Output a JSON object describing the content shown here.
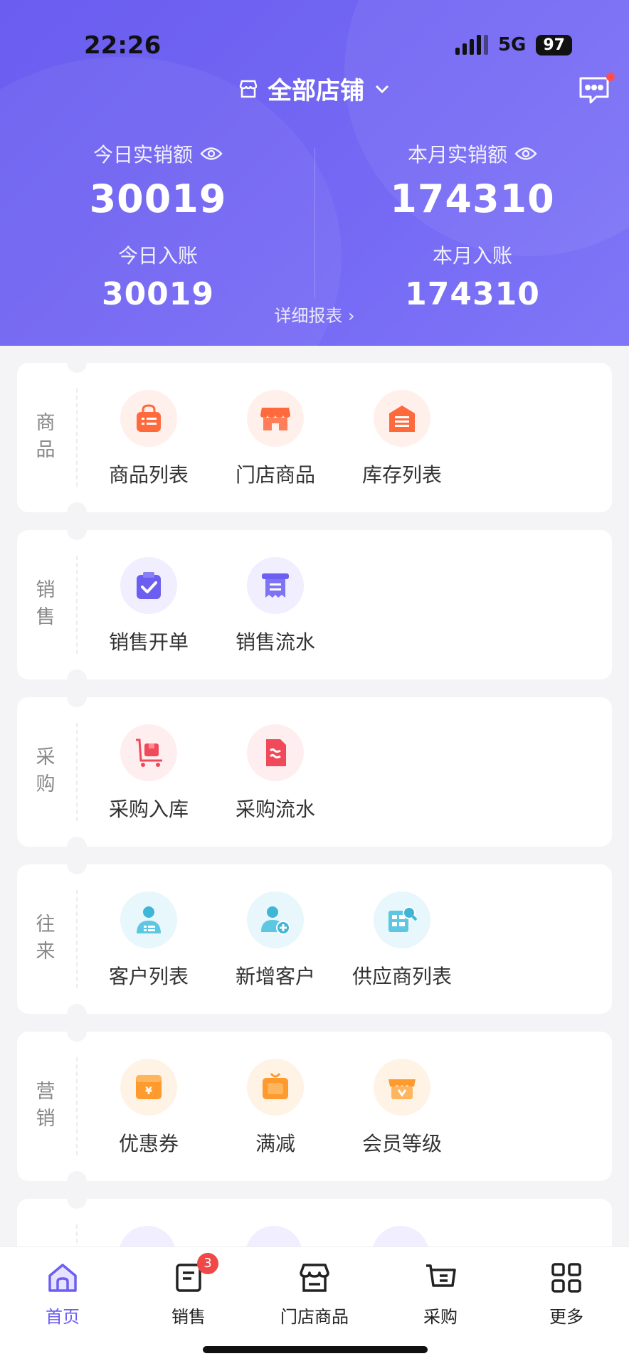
{
  "status_bar": {
    "time": "22:26",
    "network": "5G",
    "battery": "97"
  },
  "header": {
    "store_selector": "全部店铺",
    "stats": {
      "today_sales_label": "今日实销额",
      "today_sales_value": "30019",
      "month_sales_label": "本月实销额",
      "month_sales_value": "174310",
      "today_income_label": "今日入账",
      "today_income_value": "30019",
      "month_income_label": "本月入账",
      "month_income_value": "174310"
    },
    "detail_link": "详细报表 ›"
  },
  "sections": [
    {
      "label": "商品",
      "items": [
        {
          "label": "商品列表",
          "icon": "shopping-bag-icon"
        },
        {
          "label": "门店商品",
          "icon": "storefront-icon"
        },
        {
          "label": "库存列表",
          "icon": "warehouse-icon"
        }
      ]
    },
    {
      "label": "销售",
      "items": [
        {
          "label": "销售开单",
          "icon": "clipboard-check-icon"
        },
        {
          "label": "销售流水",
          "icon": "receipt-icon"
        }
      ]
    },
    {
      "label": "采购",
      "items": [
        {
          "label": "采购入库",
          "icon": "cart-box-icon"
        },
        {
          "label": "采购流水",
          "icon": "document-icon"
        }
      ]
    },
    {
      "label": "往来",
      "items": [
        {
          "label": "客户列表",
          "icon": "customer-icon"
        },
        {
          "label": "新增客户",
          "icon": "add-customer-icon"
        },
        {
          "label": "供应商列表",
          "icon": "supplier-search-icon"
        }
      ]
    },
    {
      "label": "营销",
      "items": [
        {
          "label": "优惠券",
          "icon": "coupon-icon"
        },
        {
          "label": "满减",
          "icon": "discount-icon"
        },
        {
          "label": "会员等级",
          "icon": "member-level-icon"
        }
      ]
    }
  ],
  "bottom_nav": [
    {
      "label": "首页",
      "icon": "home-icon",
      "active": true
    },
    {
      "label": "销售",
      "icon": "sales-doc-icon",
      "badge": "3"
    },
    {
      "label": "门店商品",
      "icon": "store-icon"
    },
    {
      "label": "采购",
      "icon": "cart-icon"
    },
    {
      "label": "更多",
      "icon": "grid-icon"
    }
  ],
  "colors": {
    "primary": "#6b5ef0",
    "badge": "#f04848"
  }
}
